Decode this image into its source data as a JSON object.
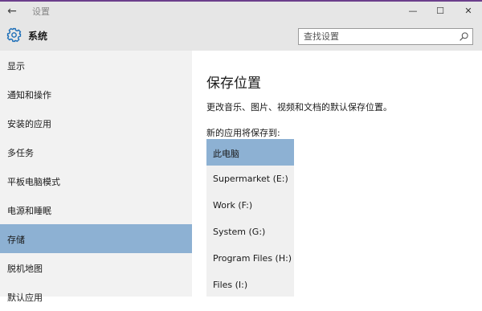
{
  "window": {
    "title": "设置",
    "back_glyph": "←",
    "minimize_glyph": "—",
    "maximize_glyph": "☐",
    "close_glyph": "✕"
  },
  "header": {
    "title": "系统",
    "icon": "gear-icon"
  },
  "search": {
    "placeholder": "查找设置",
    "icon": "search-icon"
  },
  "sidebar": {
    "items": [
      {
        "label": "显示"
      },
      {
        "label": "通知和操作"
      },
      {
        "label": "安装的应用"
      },
      {
        "label": "多任务"
      },
      {
        "label": "平板电脑模式"
      },
      {
        "label": "电源和睡眠"
      },
      {
        "label": "存储",
        "active": true
      },
      {
        "label": "脱机地图"
      },
      {
        "label": "默认应用"
      }
    ]
  },
  "main": {
    "title": "保存位置",
    "description": "更改音乐、图片、视频和文档的默认保存位置。",
    "select_label": "新的应用将保存到:",
    "options": [
      {
        "label": "此电脑",
        "selected": true
      },
      {
        "label": "Supermarket (E:)"
      },
      {
        "label": "Work (F:)"
      },
      {
        "label": "System (G:)"
      },
      {
        "label": "Program Files (H:)"
      },
      {
        "label": "Files (I:)"
      }
    ]
  },
  "colors": {
    "accent_selected": "#8db1d3",
    "titlebar": "#e6e6e6",
    "sidebar": "#f2f2f2",
    "dropdown": "#f0f0f0",
    "gear": "#1e6fb8"
  }
}
